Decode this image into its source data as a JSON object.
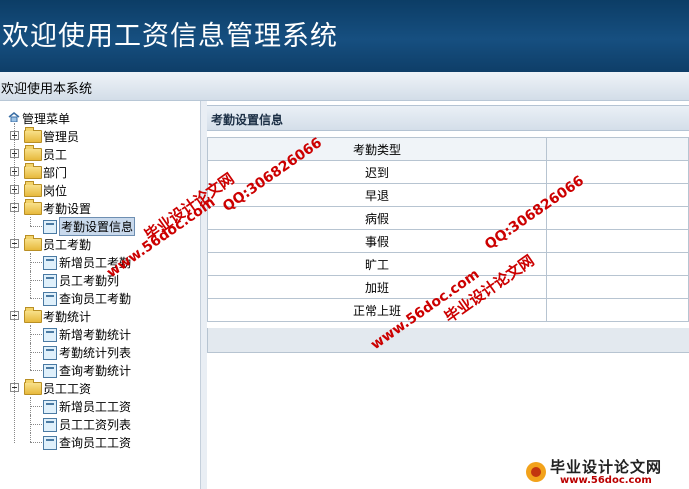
{
  "header": {
    "title": "欢迎使用工资信息管理系统"
  },
  "welcome": {
    "text": "欢迎使用本系统"
  },
  "sidebar": {
    "root": "管理菜单",
    "groups": [
      {
        "label": "管理员",
        "expanded": false,
        "items": []
      },
      {
        "label": "员工",
        "expanded": false,
        "items": []
      },
      {
        "label": "部门",
        "expanded": false,
        "items": []
      },
      {
        "label": "岗位",
        "expanded": false,
        "items": []
      },
      {
        "label": "考勤设置",
        "expanded": true,
        "items": [
          "考勤设置信息"
        ]
      },
      {
        "label": "员工考勤",
        "expanded": true,
        "items": [
          "新增员工考勤",
          "员工考勤列",
          "查询员工考勤"
        ]
      },
      {
        "label": "考勤统计",
        "expanded": true,
        "items": [
          "新增考勤统计",
          "考勤统计列表",
          "查询考勤统计"
        ]
      },
      {
        "label": "员工工资",
        "expanded": true,
        "items": [
          "新增员工工资",
          "员工工资列表",
          "查询员工工资"
        ]
      }
    ],
    "selected": "考勤设置信息"
  },
  "panel": {
    "title": "考勤设置信息",
    "column_header": "考勤类型",
    "rows": [
      "迟到",
      "早退",
      "病假",
      "事假",
      "旷工",
      "加班",
      "正常上班"
    ]
  },
  "watermarks": {
    "site_name": "毕业设计论文网",
    "url": "www.56doc.com",
    "qq": "QQ:306826066"
  },
  "logo": {
    "name": "毕业设计论文网",
    "url": "www.56doc.com"
  },
  "colors": {
    "header_bg": "#164f80",
    "watermark": "#cc0000",
    "selection": "#c9d9ec"
  }
}
